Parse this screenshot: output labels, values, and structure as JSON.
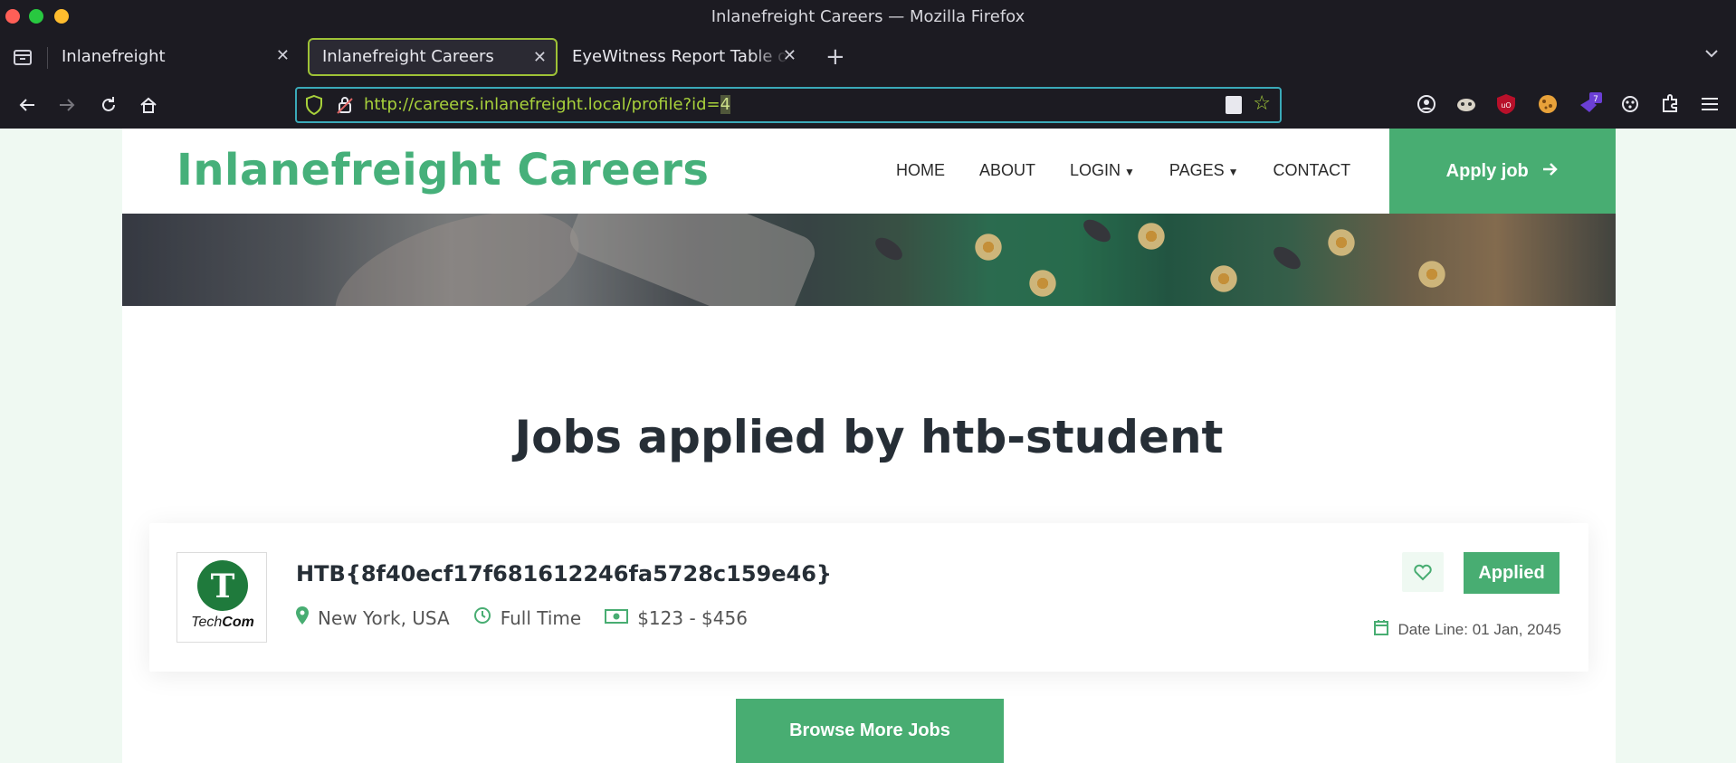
{
  "window": {
    "title": "Inlanefreight Careers — Mozilla Firefox"
  },
  "tabs": [
    {
      "label": "Inlanefreight",
      "active": false
    },
    {
      "label": "Inlanefreight Careers",
      "active": true
    },
    {
      "label": "EyeWitness Report Table of Contents",
      "active": false
    }
  ],
  "urlbar": {
    "url_prefix": "http://careers.inlanefreight.local/profile?id=",
    "url_id": "4"
  },
  "extensions": {
    "badge_count": "7"
  },
  "site": {
    "brand": "Inlanefreight Careers",
    "menu": [
      "HOME",
      "ABOUT",
      "LOGIN",
      "PAGES",
      "CONTACT"
    ],
    "apply_label": "Apply job"
  },
  "main": {
    "heading": "Jobs applied by htb-student",
    "job": {
      "logo_text_1": "Tech",
      "logo_text_2": "Com",
      "title": "HTB{8f40ecf17f681612246fa5728c159e46}",
      "location": "New York, USA",
      "type": "Full Time",
      "salary": "$123 - $456",
      "status": "Applied",
      "date_line": "Date Line: 01 Jan, 2045"
    },
    "browse_label": "Browse More Jobs"
  },
  "colors": {
    "accent": "#48ad72",
    "brand": "#46b07a",
    "url": "#a8d13b",
    "chrome": "#1c1b22"
  }
}
